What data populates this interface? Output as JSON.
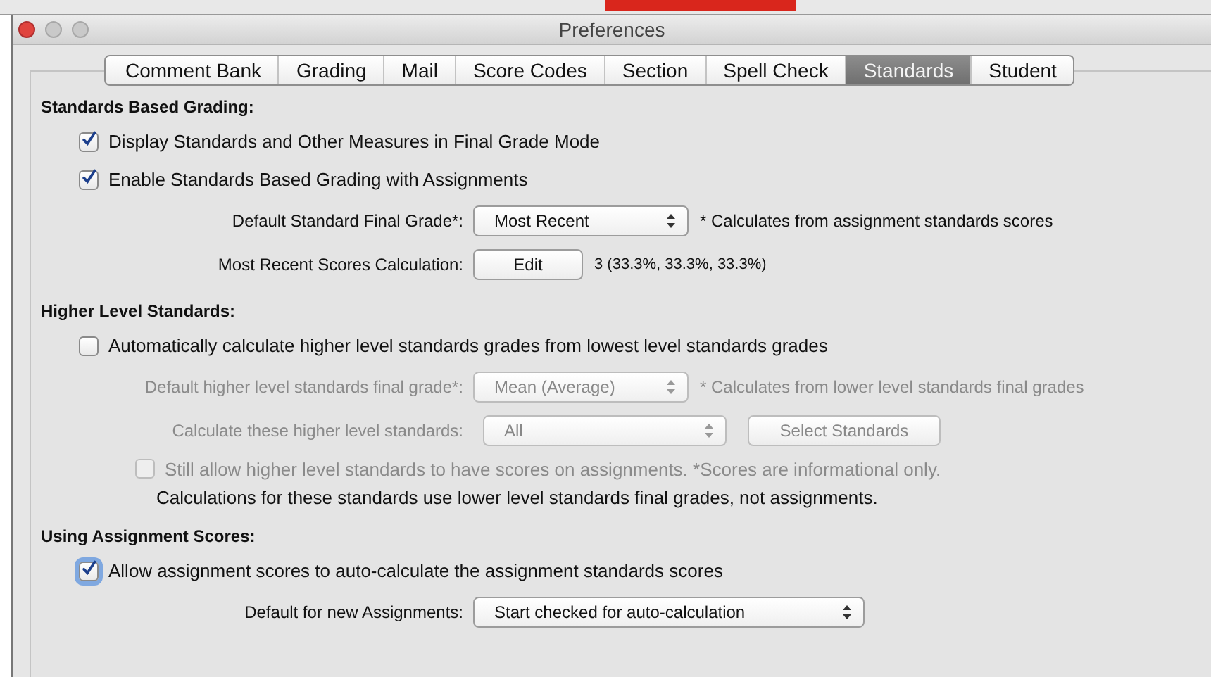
{
  "window": {
    "title": "Preferences"
  },
  "tabs": [
    {
      "label": "Comment Bank",
      "selected": false
    },
    {
      "label": "Grading",
      "selected": false
    },
    {
      "label": "Mail",
      "selected": false
    },
    {
      "label": "Score Codes",
      "selected": false
    },
    {
      "label": "Section",
      "selected": false
    },
    {
      "label": "Spell Check",
      "selected": false
    },
    {
      "label": "Standards",
      "selected": true
    },
    {
      "label": "Student",
      "selected": false
    }
  ],
  "sections": [
    {
      "heading": "Standards Based Grading:",
      "items": [
        {
          "kind": "checkbox",
          "label": "Display Standards and Other Measures in Final Grade Mode",
          "checked": true,
          "disabled": false
        },
        {
          "kind": "checkbox",
          "label": "Enable Standards Based Grading with Assignments",
          "checked": true,
          "disabled": false
        },
        {
          "kind": "select",
          "label": "Default Standard Final Grade*:",
          "value": "Most Recent",
          "note": "* Calculates from assignment standards scores",
          "disabled": false
        },
        {
          "kind": "button",
          "label": "Most Recent Scores Calculation:",
          "button": "Edit",
          "note": "3 (33.3%, 33.3%, 33.3%)",
          "disabled": false
        }
      ]
    },
    {
      "heading": "Higher Level Standards:",
      "items": [
        {
          "kind": "checkbox",
          "label": "Automatically calculate higher level standards grades from lowest level standards grades",
          "checked": false,
          "disabled": false
        },
        {
          "kind": "select",
          "label": "Default higher level standards final grade*:",
          "value": "Mean (Average)",
          "note": "* Calculates from lower level standards final grades",
          "disabled": true
        },
        {
          "kind": "select",
          "label": "Calculate these higher level standards:",
          "value": "All",
          "button": "Select Standards",
          "disabled": true
        },
        {
          "kind": "subcheckbox",
          "label": "Still allow higher level standards to have scores on assignments.  *Scores are informational only.",
          "checked": false,
          "disabled": true
        },
        {
          "kind": "note",
          "label": "Calculations for these standards use lower level standards final grades, not assignments."
        }
      ]
    },
    {
      "heading": "Using Assignment Scores:",
      "items": [
        {
          "kind": "checkbox",
          "label": "Allow assignment scores to auto-calculate the assignment standards scores",
          "checked": true,
          "disabled": false,
          "focused": true
        },
        {
          "kind": "select",
          "label": "Default for new Assignments:",
          "value": "Start checked for auto-calculation",
          "disabled": false,
          "wide": true
        }
      ]
    }
  ]
}
